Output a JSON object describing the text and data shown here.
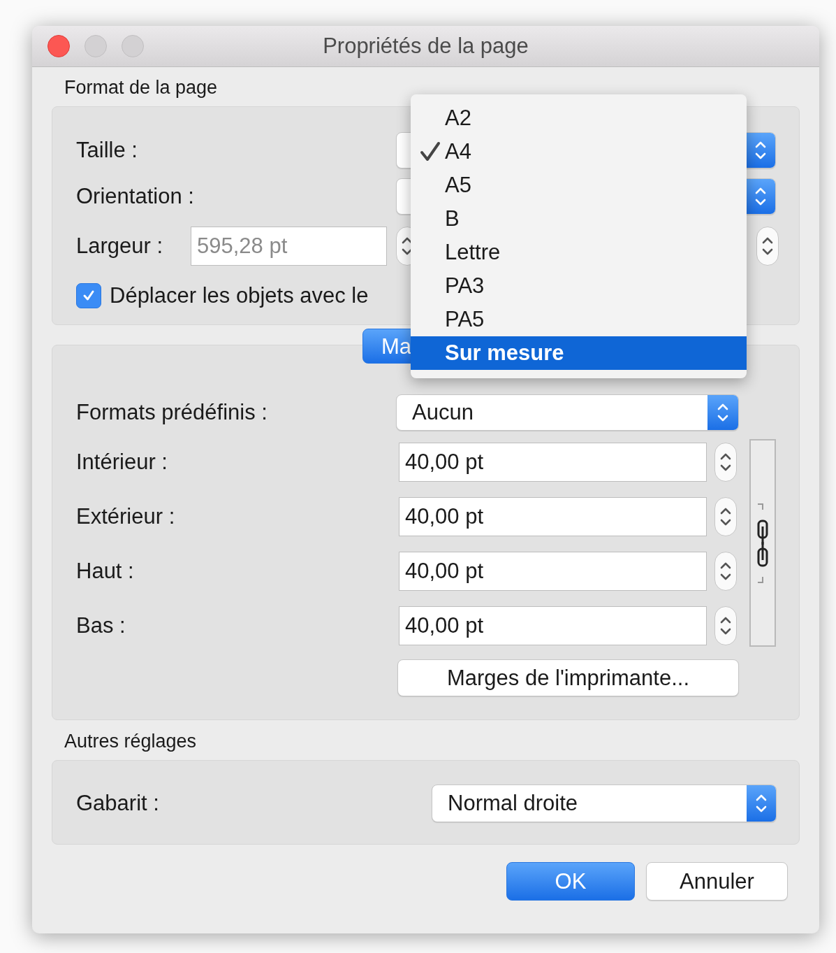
{
  "window": {
    "title": "Propriétés de la page"
  },
  "page_format": {
    "heading": "Format de la page",
    "size_label": "Taille :",
    "orientation_label": "Orientation :",
    "width_label": "Largeur :",
    "width_field": {
      "value": "595,28 pt",
      "disabled": true
    },
    "move_objects": {
      "label": "Déplacer les objets avec le",
      "checked": true
    }
  },
  "margins": {
    "tabs": [
      {
        "label": "Ma",
        "selected": true
      }
    ],
    "presets_label": "Formats prédéfinis :",
    "presets_value": "Aucun",
    "fields": [
      {
        "label": "Intérieur :",
        "value": "40,00 pt"
      },
      {
        "label": "Extérieur :",
        "value": "40,00 pt"
      },
      {
        "label": "Haut :",
        "value": "40,00 pt"
      },
      {
        "label": "Bas :",
        "value": "40,00 pt"
      }
    ],
    "printer_margins_button": "Marges de l'imprimante..."
  },
  "other_settings": {
    "heading": "Autres réglages",
    "template_label": "Gabarit :",
    "template_value": "Normal droite"
  },
  "buttons": [
    {
      "label": "OK",
      "kind": "default"
    },
    {
      "label": "Annuler",
      "kind": "normal"
    }
  ],
  "size_menu": {
    "items": [
      {
        "label": "A2",
        "checked": false,
        "selected": false
      },
      {
        "label": "A4",
        "checked": true,
        "selected": false
      },
      {
        "label": "A5",
        "checked": false,
        "selected": false
      },
      {
        "label": "B",
        "checked": false,
        "selected": false
      },
      {
        "label": "Lettre",
        "checked": false,
        "selected": false
      },
      {
        "label": "PA3",
        "checked": false,
        "selected": false
      },
      {
        "label": "PA5",
        "checked": false,
        "selected": false
      },
      {
        "label": "Sur mesure",
        "checked": false,
        "selected": true
      }
    ]
  }
}
